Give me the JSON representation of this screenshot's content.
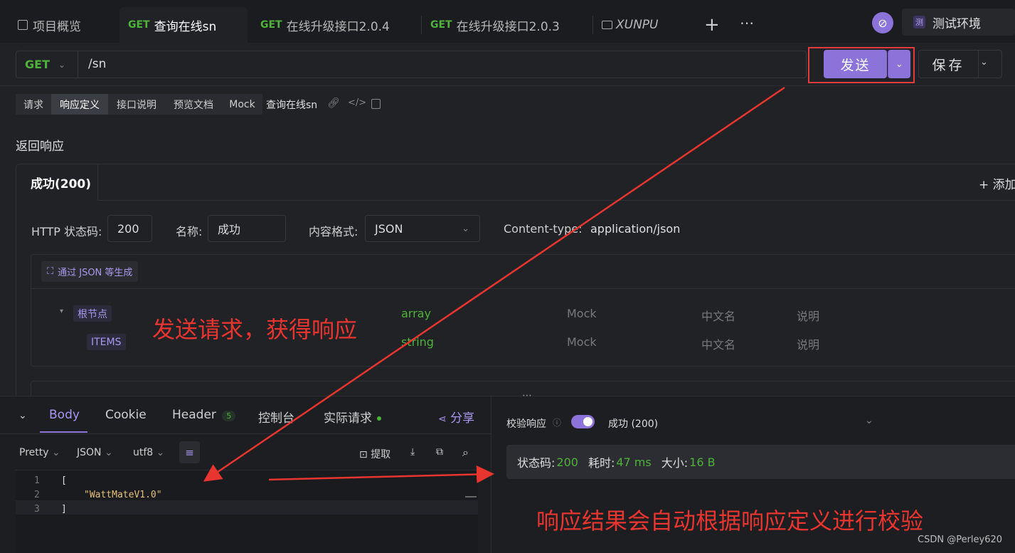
{
  "tabs": [
    {
      "method": "",
      "label": "项目概览"
    },
    {
      "method": "GET",
      "label": "查询在线sn"
    },
    {
      "method": "GET",
      "label": "在线升级接口2.0.4"
    },
    {
      "method": "GET",
      "label": "在线升级接口2.0.3"
    },
    {
      "method": "",
      "label": "XUNPU"
    }
  ],
  "env": {
    "badge": "测",
    "label": "测试环境"
  },
  "request": {
    "method": "GET",
    "path": "/sn",
    "send": "发送",
    "save": "保存"
  },
  "subtabs": [
    "请求",
    "响应定义",
    "接口说明",
    "预览文档",
    "Mock"
  ],
  "api_name": "查询在线sn",
  "section_title": "返回响应",
  "response_tab": "成功(200)",
  "add_label": "+ 添加",
  "fields": {
    "status_label": "HTTP 状态码:",
    "status_value": "200",
    "name_label": "名称:",
    "name_value": "成功",
    "format_label": "内容格式:",
    "format_value": "JSON",
    "ctype_label": "Content-type:",
    "ctype_value": "application/json"
  },
  "gen_button": "通过 JSON 等生成",
  "tree": [
    {
      "name": "根节点",
      "type": "array",
      "mock": "Mock",
      "cn": "中文名",
      "desc": "说明"
    },
    {
      "name": "ITEMS",
      "type": "string",
      "mock": "Mock",
      "cn": "中文名",
      "desc": "说明"
    }
  ],
  "annotations": {
    "a1": "发送请求，获得响应",
    "a2": "响应结果会自动根据响应定义进行校验"
  },
  "bottom_tabs": {
    "body": "Body",
    "cookie": "Cookie",
    "header": "Header",
    "header_count": "5",
    "console": "控制台",
    "actual": "实际请求",
    "share": "分享"
  },
  "toolbar": {
    "pretty": "Pretty",
    "json": "JSON",
    "encoding": "utf8",
    "extract": "提取"
  },
  "code_lines": [
    "[",
    "\"WattMateV1.0\"",
    "]"
  ],
  "line_numbers": [
    "1",
    "2",
    "3"
  ],
  "validation": {
    "label": "校验响应",
    "result": "成功 (200)"
  },
  "stats": {
    "status_label": "状态码:",
    "status": "200",
    "time_label": "耗时:",
    "time": "47 ms",
    "size_label": "大小:",
    "size": "16 B"
  },
  "watermark": "CSDN @Perley620",
  "colors": {
    "accent": "#8b73d9",
    "green": "#4fb23a",
    "annotation": "#e8352f"
  }
}
